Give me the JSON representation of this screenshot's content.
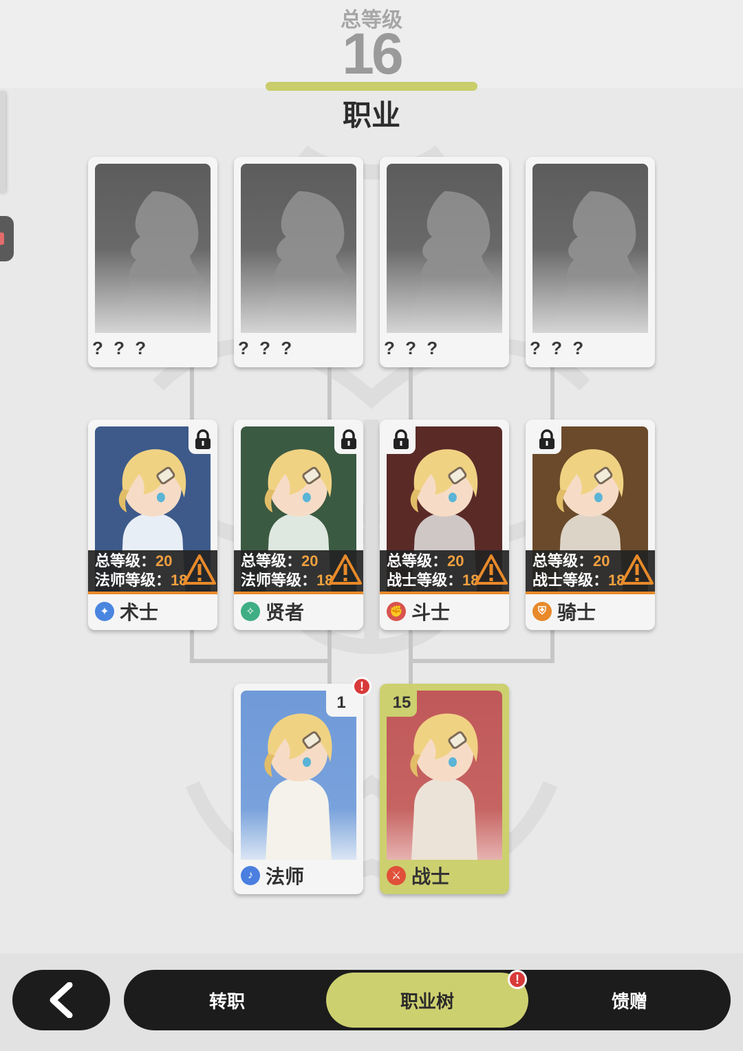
{
  "header": {
    "total_level_label": "总等级",
    "total_level_value": "16",
    "title": "职业"
  },
  "tier3": [
    {
      "name": "? ? ?"
    },
    {
      "name": "? ? ?"
    },
    {
      "name": "? ? ?"
    },
    {
      "name": "? ? ?"
    }
  ],
  "tier2": [
    {
      "name": "术士",
      "req_total_label": "总等级：",
      "req_total": "20",
      "req_class_label": "法师等级：",
      "req_class": "18",
      "bg": "#3d5a8a",
      "icon_color": "#4a86e0",
      "coat": "#e8eef6"
    },
    {
      "name": "贤者",
      "req_total_label": "总等级：",
      "req_total": "20",
      "req_class_label": "法师等级：",
      "req_class": "18",
      "bg": "#3b5a42",
      "icon_color": "#3fae84",
      "coat": "#dfe8e0"
    },
    {
      "name": "斗士",
      "req_total_label": "总等级：",
      "req_total": "20",
      "req_class_label": "战士等级：",
      "req_class": "18",
      "bg": "#5a2a27",
      "icon_color": "#d9534f",
      "coat": "#cfc7c5"
    },
    {
      "name": "骑士",
      "req_total_label": "总等级：",
      "req_total": "20",
      "req_class_label": "战士等级：",
      "req_class": "18",
      "bg": "#6a4a2a",
      "icon_color": "#e8892a",
      "coat": "#ddd4c8"
    }
  ],
  "tier1": [
    {
      "name": "法师",
      "level": "1",
      "bg_top": "#6f9ad8",
      "bg_bottom": "#dbe6f4",
      "icon_color": "#4a7fe0",
      "coat": "#f4f2ea"
    },
    {
      "name": "战士",
      "level": "15",
      "bg_top": "#c0585a",
      "bg_bottom": "#e6b3b0",
      "icon_color": "#e0503a",
      "coat": "#ece3d8"
    }
  ],
  "nav": {
    "transfer": "转职",
    "tree": "职业树",
    "gift": "馈赠"
  },
  "colors": {
    "accent": "#cdd06f",
    "warning": "#e88a2a",
    "alert": "#d93a3a",
    "nav_bg": "#1c1c1c"
  },
  "icons": {
    "lock": "lock-icon",
    "warning": "warning-triangle-icon",
    "alert": "alert-exclamation-icon",
    "back": "chevron-left-icon"
  }
}
